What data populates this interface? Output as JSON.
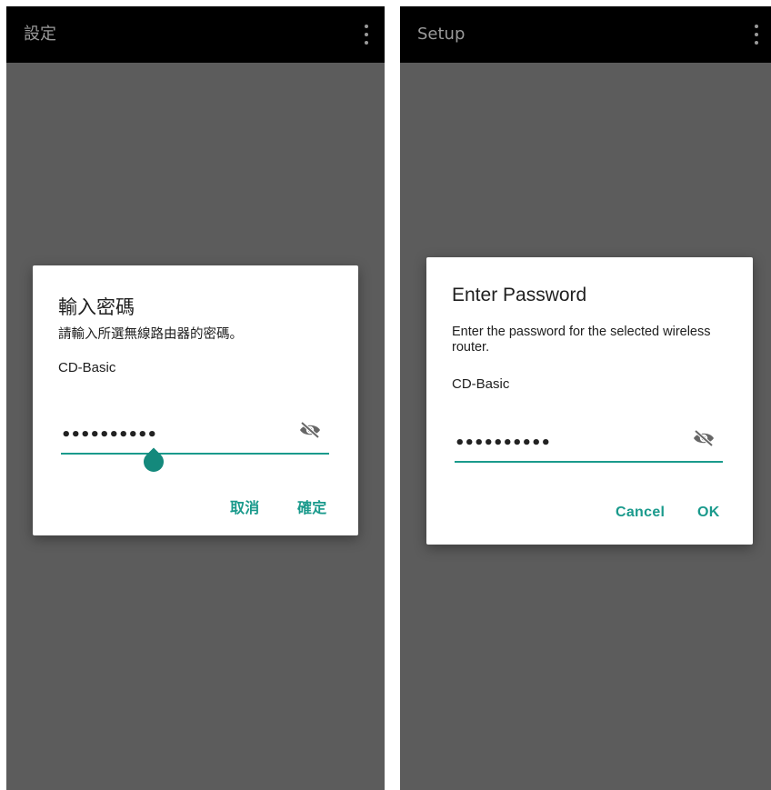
{
  "colors": {
    "accent": "#1a9a8c",
    "appbar_bg": "#000000",
    "scrim": "#5c5c5c",
    "dialog_bg": "#ffffff"
  },
  "screens": [
    {
      "appbar": {
        "title": "設定",
        "menu_icon": "more-vert-icon"
      },
      "dialog": {
        "title": "輸入密碼",
        "message": "請輸入所選無線路由器的密碼。",
        "ssid": "CD-Basic",
        "password_masked": "••••••••••",
        "visibility_icon": "visibility-off-icon",
        "cancel_label": "取消",
        "ok_label": "確定"
      }
    },
    {
      "appbar": {
        "title": "Setup",
        "menu_icon": "more-vert-icon"
      },
      "dialog": {
        "title": "Enter Password",
        "message": "Enter the password for the selected wireless router.",
        "ssid": "CD-Basic",
        "password_masked": "••••••••••",
        "visibility_icon": "visibility-off-icon",
        "cancel_label": "Cancel",
        "ok_label": "OK"
      }
    }
  ]
}
